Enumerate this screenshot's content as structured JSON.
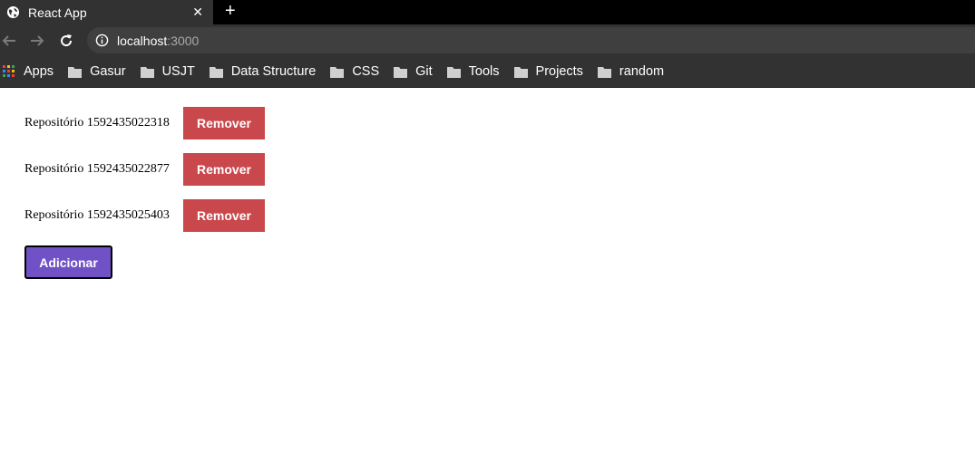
{
  "browser": {
    "tab_title": "React App",
    "new_tab_label": "+",
    "close_tab_label": "✕",
    "url_host": "localhost",
    "url_port": ":3000",
    "bookmarks": [
      {
        "label": "Apps",
        "icon": "apps-grid-icon"
      },
      {
        "label": "Gasur",
        "icon": "folder-icon"
      },
      {
        "label": "USJT",
        "icon": "folder-icon"
      },
      {
        "label": "Data Structure",
        "icon": "folder-icon"
      },
      {
        "label": "CSS",
        "icon": "folder-icon"
      },
      {
        "label": "Git",
        "icon": "folder-icon"
      },
      {
        "label": "Tools",
        "icon": "folder-icon"
      },
      {
        "label": "Projects",
        "icon": "folder-icon"
      },
      {
        "label": "random",
        "icon": "folder-icon"
      }
    ]
  },
  "repositories": [
    {
      "label": "Repositório 1592435022318",
      "button": "Remover"
    },
    {
      "label": "Repositório 1592435022877",
      "button": "Remover"
    },
    {
      "label": "Repositório 1592435025403",
      "button": "Remover"
    }
  ],
  "add_button": "Adicionar",
  "colors": {
    "remove_button": "#c9484c",
    "add_button": "#7152c6",
    "chrome_bg": "#323232"
  }
}
